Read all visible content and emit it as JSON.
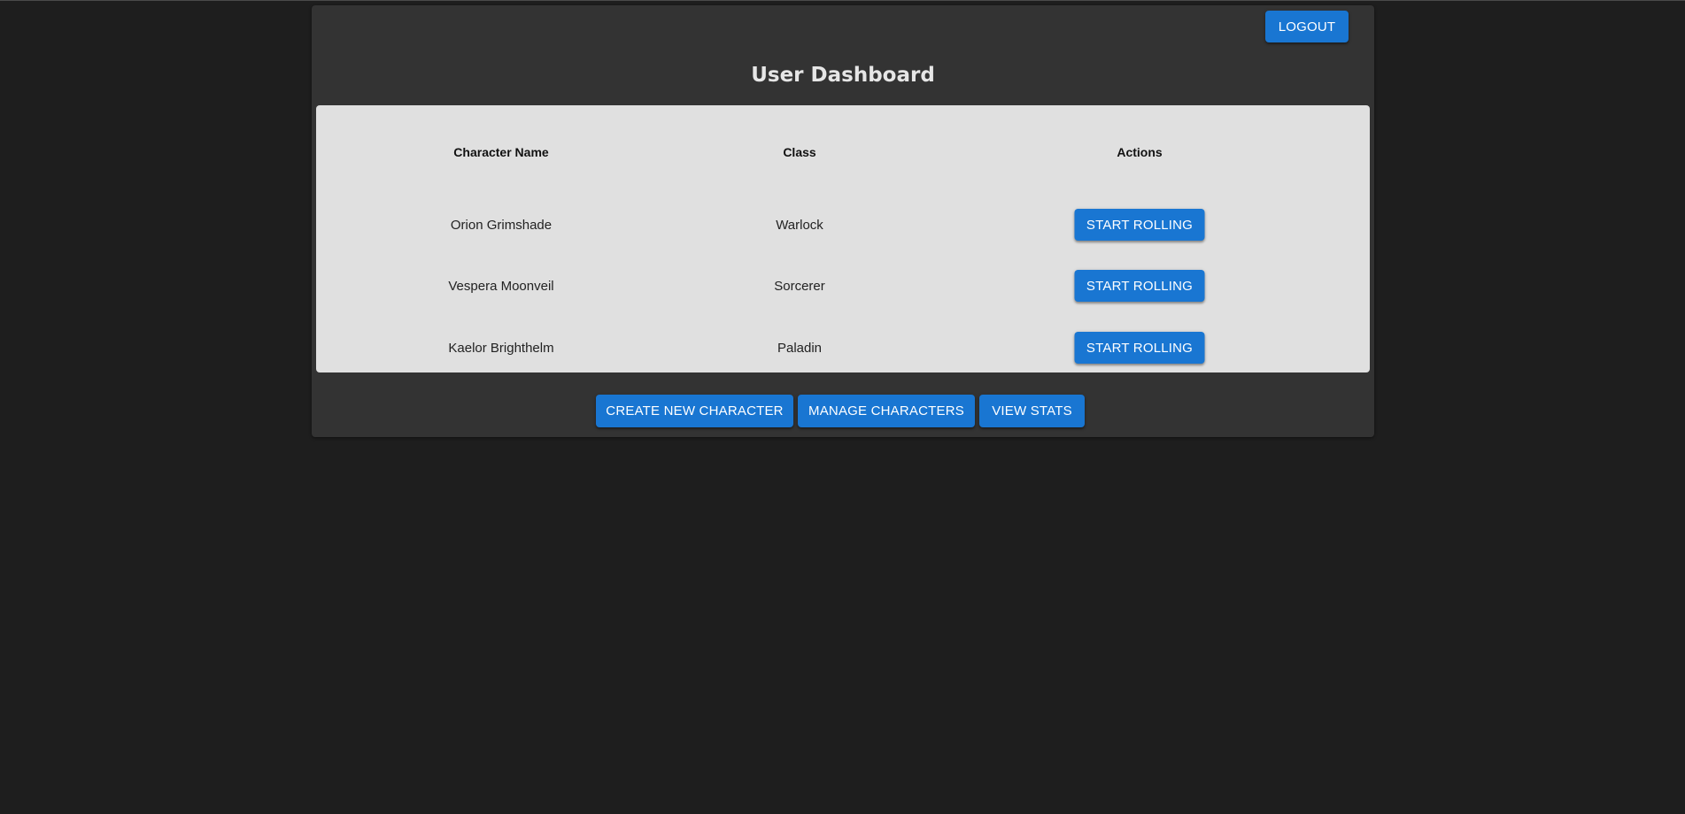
{
  "header": {
    "logout_label": "LOGOUT",
    "title": "User Dashboard"
  },
  "table": {
    "columns": [
      "Character Name",
      "Class",
      "Actions"
    ],
    "rows": [
      {
        "name": "Orion Grimshade",
        "class": "Warlock",
        "action": "START ROLLING"
      },
      {
        "name": "Vespera Moonveil",
        "class": "Sorcerer",
        "action": "START ROLLING"
      },
      {
        "name": "Kaelor Brighthelm",
        "class": "Paladin",
        "action": "START ROLLING"
      }
    ]
  },
  "footer": {
    "create_label": "CREATE NEW CHARACTER",
    "manage_label": "MANAGE CHARACTERS",
    "stats_label": "VIEW STATS"
  },
  "colors": {
    "background": "#1e1e1e",
    "card": "#333333",
    "panel": "#e0e0e0",
    "accent": "#1976d2"
  }
}
